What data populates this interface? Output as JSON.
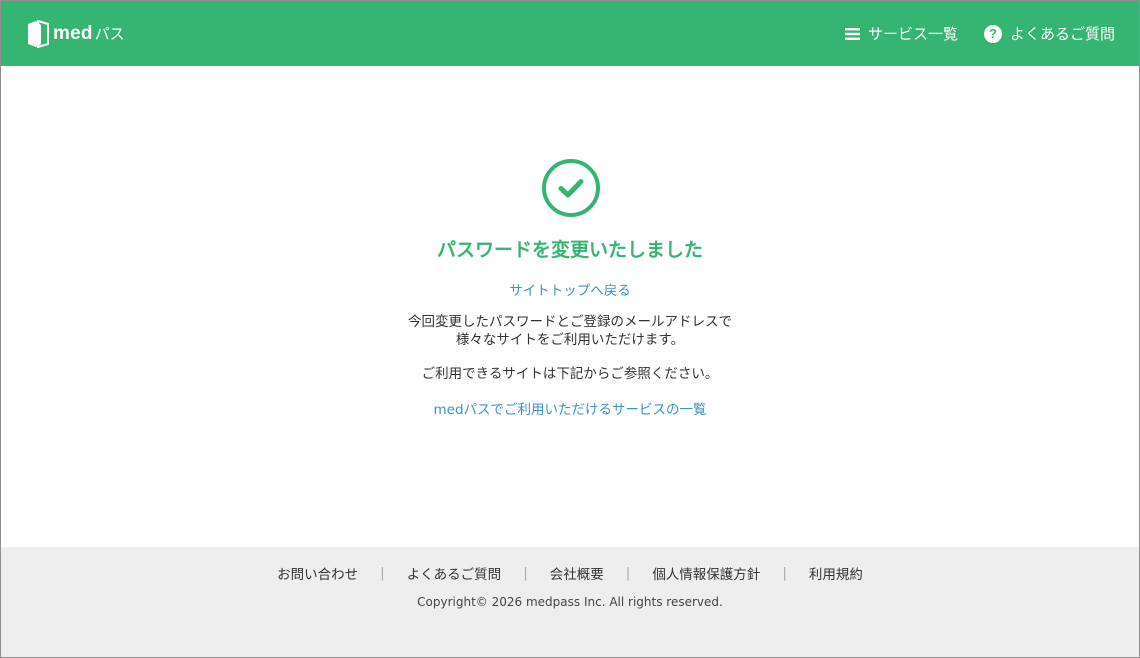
{
  "header": {
    "logo": {
      "med": "med",
      "pass": "パス"
    },
    "nav": {
      "services": "サービス一覧",
      "faq": "よくあるご質問"
    }
  },
  "main": {
    "title": "パスワードを変更いたしました",
    "top_link": "サイトトップへ戻る",
    "message1_line1": "今回変更したパスワードとご登録のメールアドレスで",
    "message1_line2": "様々なサイトをご利用いただけます。",
    "message2": "ご利用できるサイトは下記からご参照ください。",
    "services_link": "medパスでご利用いただけるサービスの一覧"
  },
  "footer": {
    "links": [
      "お問い合わせ",
      "よくあるご質問",
      "会社概要",
      "個人情報保護方針",
      "利用規約"
    ],
    "copyright": "Copyright© 2026 medpass Inc. All rights reserved."
  },
  "colors": {
    "brand_green": "#35b571",
    "link_blue": "#3a94c8",
    "footer_bg": "#eeeeee"
  },
  "icons": {
    "logo": "book-logo-icon",
    "services": "hamburger-menu-icon",
    "faq": "question-circle-icon",
    "success": "check-circle-icon"
  }
}
